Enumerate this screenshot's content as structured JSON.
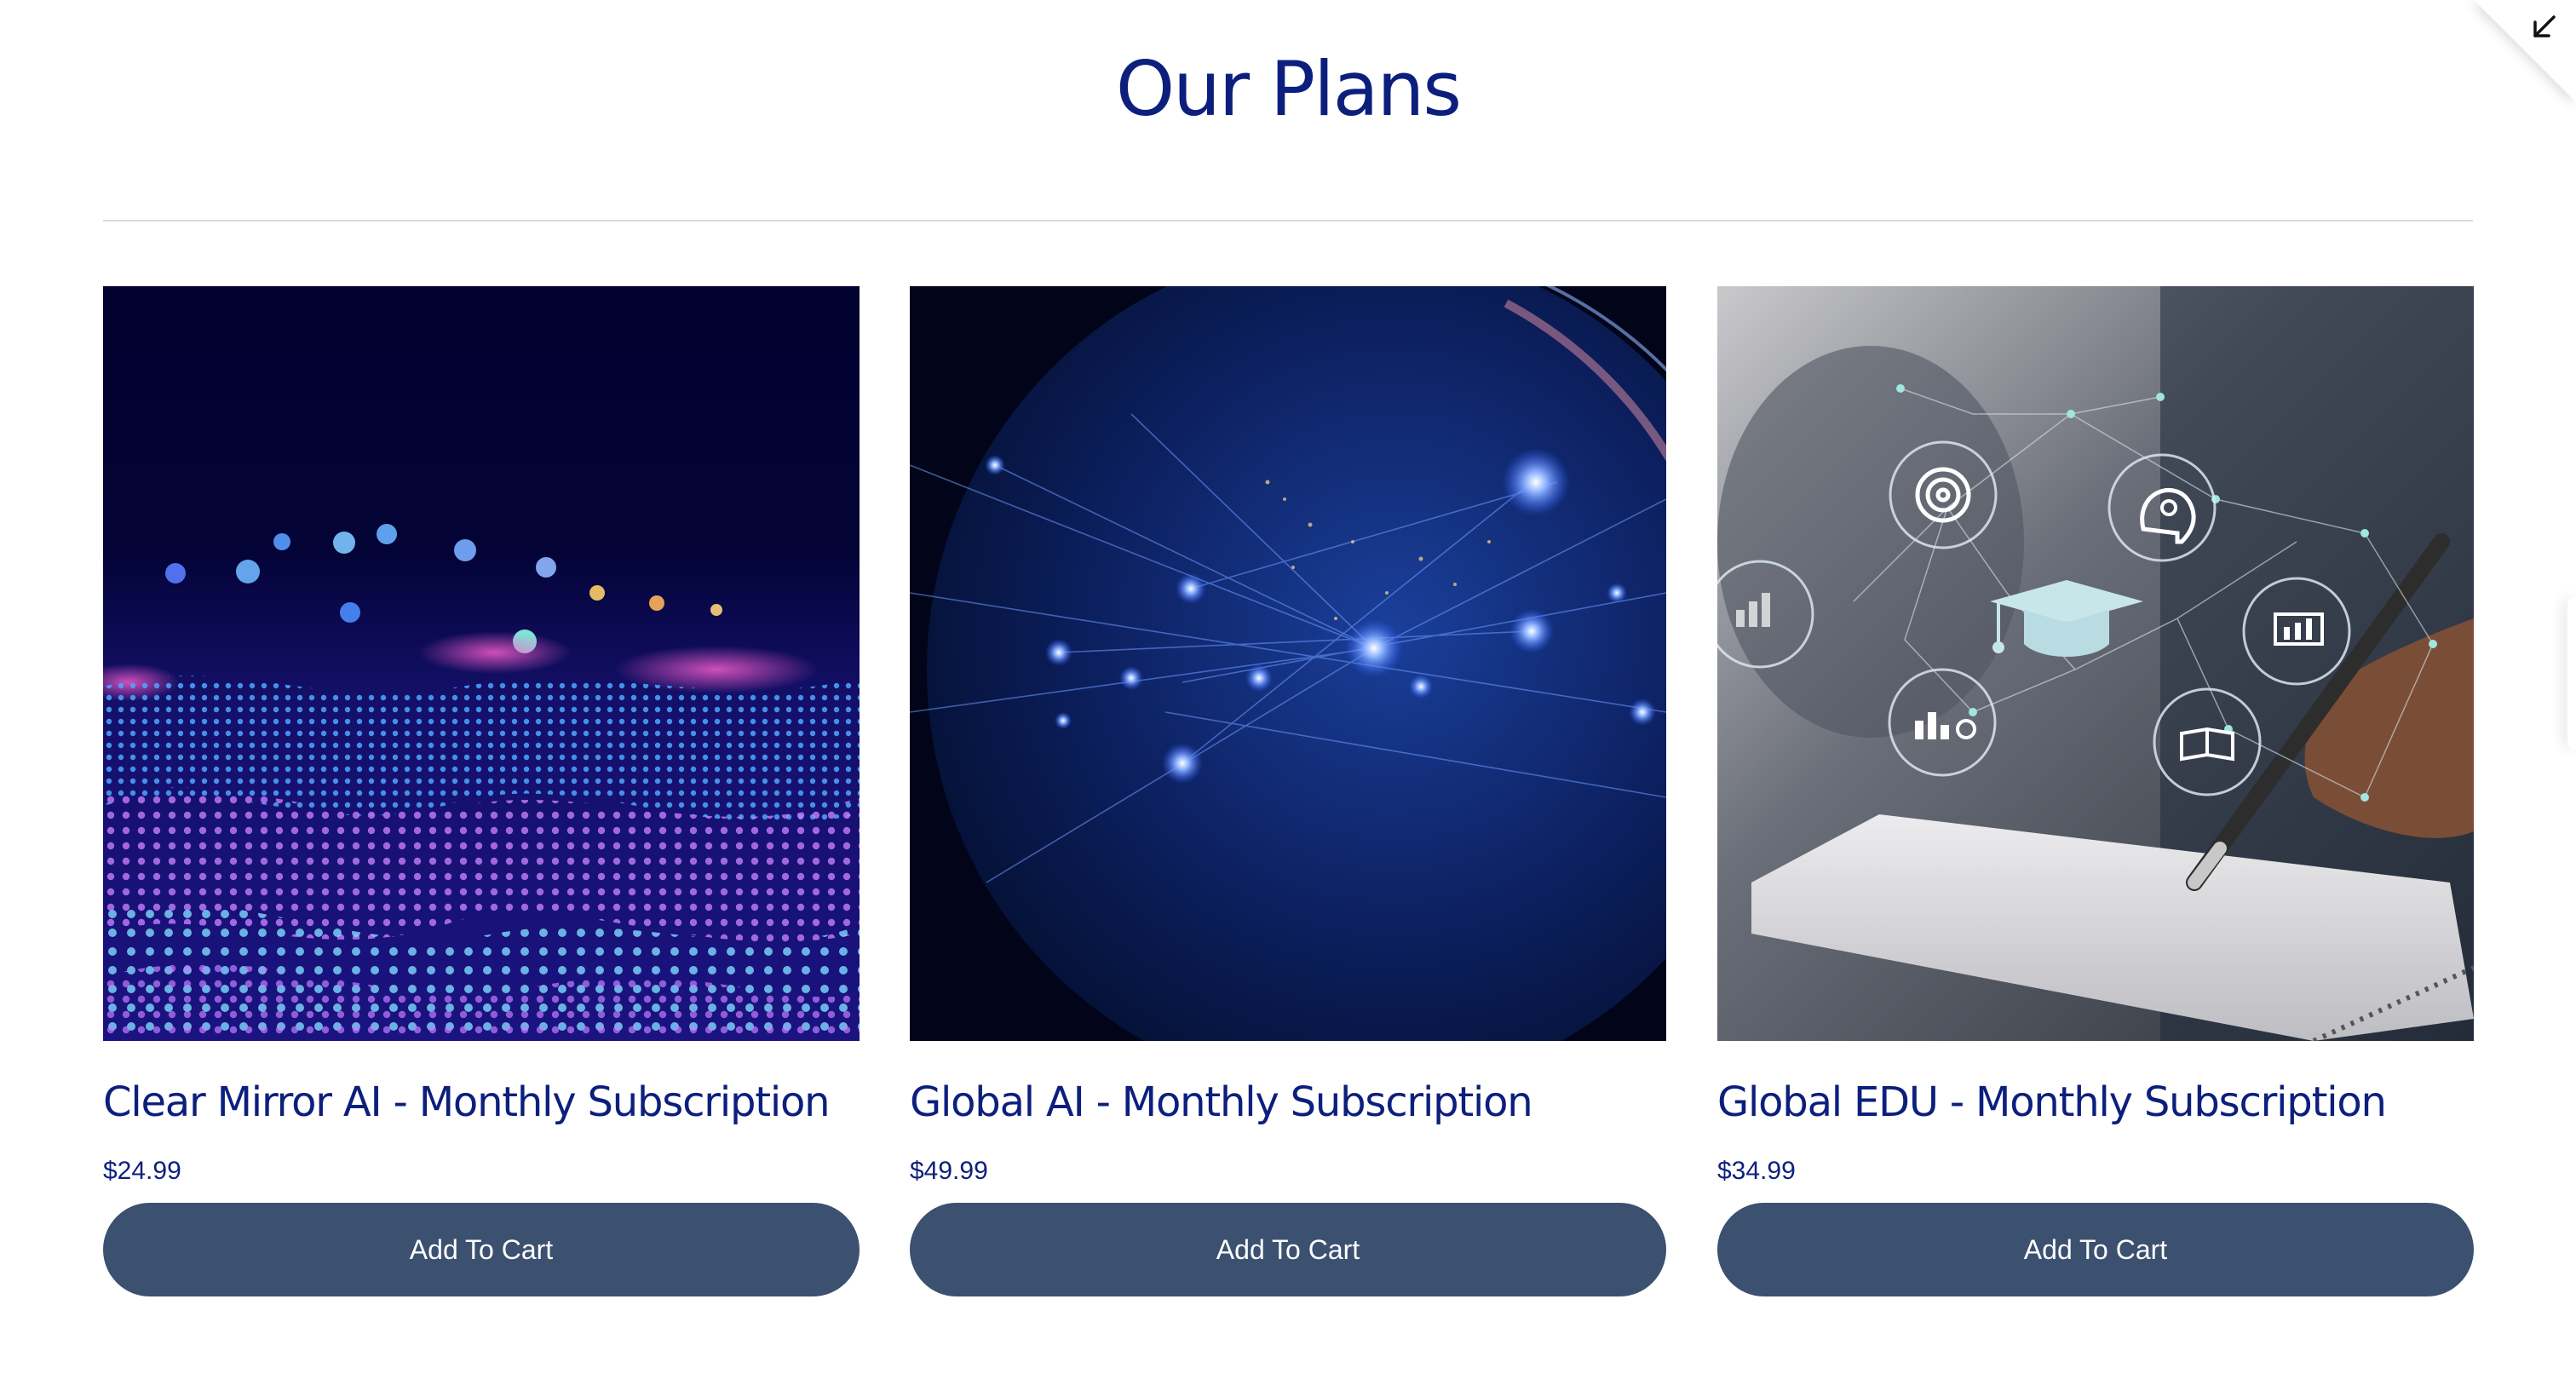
{
  "page": {
    "title": "Our Plans"
  },
  "colors": {
    "heading": "#0d1f7d",
    "button_bg": "#3c5070",
    "button_text": "#ffffff",
    "divider": "#d6d9e0"
  },
  "corner": {
    "icon": "collapse-arrow-icon"
  },
  "plans": [
    {
      "image": "digital-particle-wave-image",
      "title": "Clear Mirror AI - Monthly Subscription",
      "price": "$24.99",
      "button_label": "Add To Cart"
    },
    {
      "image": "global-network-earth-image",
      "title": "Global AI - Monthly Subscription",
      "price": "$49.99",
      "button_label": "Add To Cart"
    },
    {
      "image": "education-technology-icons-image",
      "title": "Global EDU - Monthly Subscription",
      "price": "$34.99",
      "button_label": "Add To Cart"
    }
  ]
}
